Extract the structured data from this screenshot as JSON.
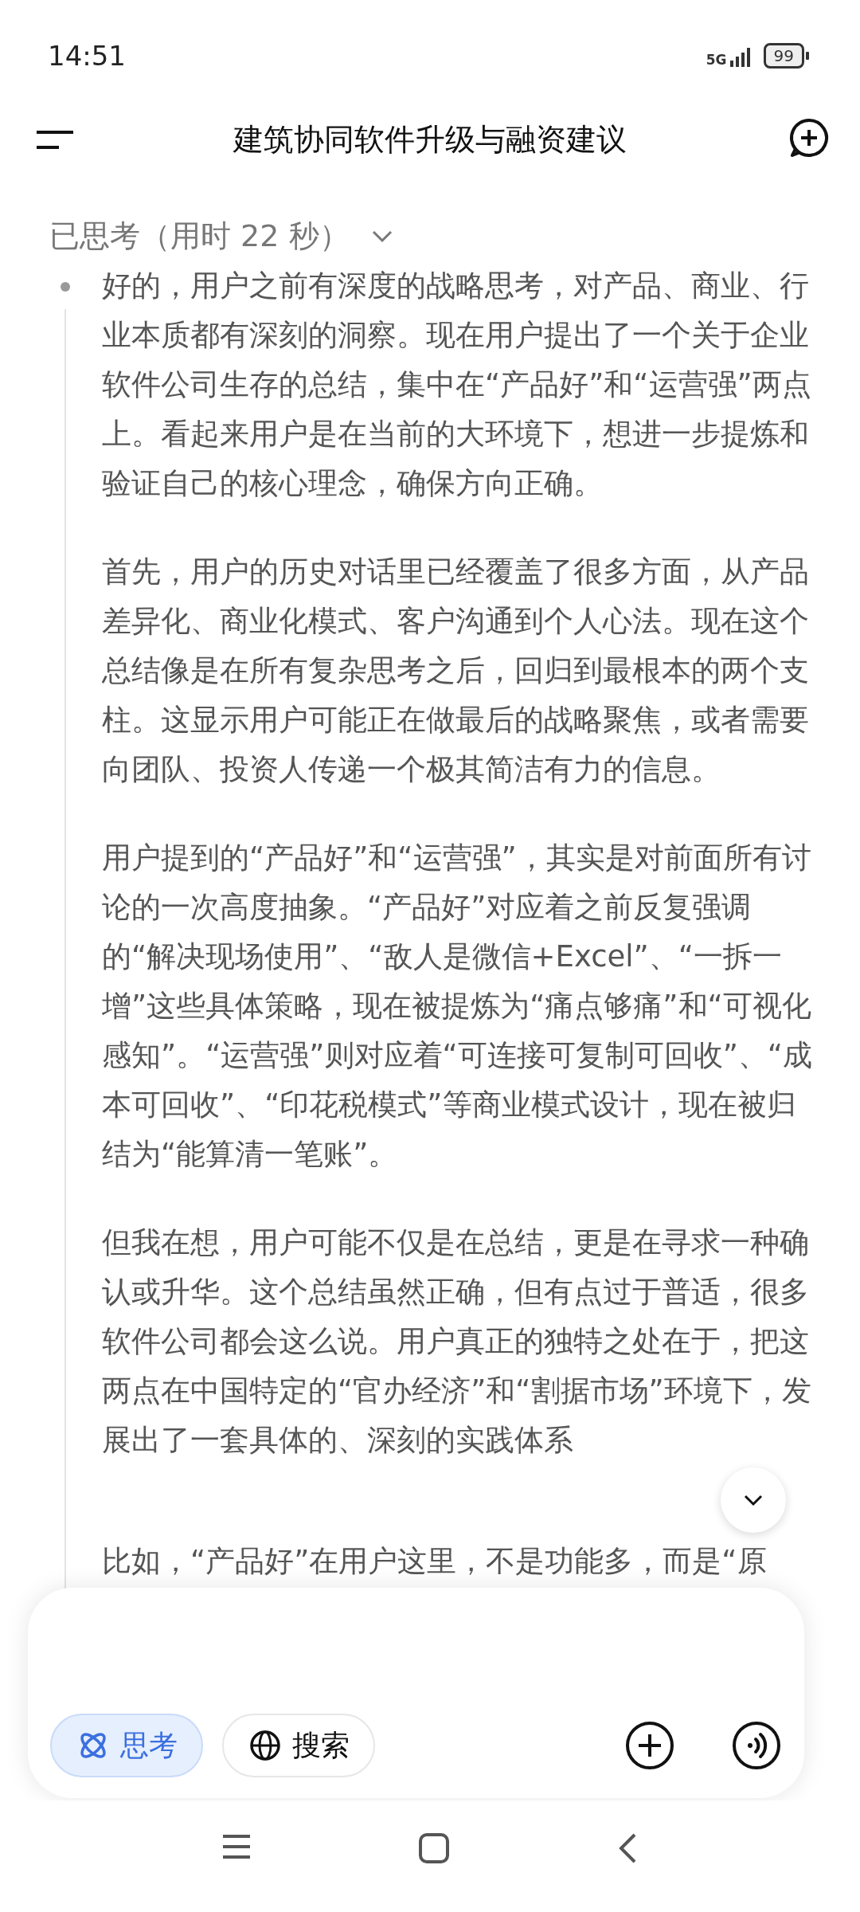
{
  "status_bar": {
    "time": "14:51",
    "network": "5G",
    "battery": "99"
  },
  "header": {
    "title": "建筑协同软件升级与融资建议"
  },
  "thinking": {
    "title": "已思考（用时 22 秒）",
    "expanded": true,
    "paragraphs": [
      "好的，用户之前有深度的战略思考，对产品、商业、行业本质都有深刻的洞察。现在用户提出了一个关于企业软件公司生存的总结，集中在“产品好”和“运营强”两点上。看起来用户是在当前的大环境下，想进一步提炼和验证自己的核心理念，确保方向正确。",
      "首先，用户的历史对话里已经覆盖了很多方面，从产品差异化、商业化模式、客户沟通到个人心法。现在这个总结像是在所有复杂思考之后，回归到最根本的两个支柱。这显示用户可能正在做最后的战略聚焦，或者需要向团队、投资人传递一个极其简洁有力的信息。",
      "用户提到的“产品好”和“运营强”，其实是对前面所有讨论的一次高度抽象。“产品好”对应着之前反复强调的“解决现场使用”、“敌人是微信+Excel”、“一拆一增”这些具体策略，现在被提炼为“痛点够痛”和“可视化感知”。“运营强”则对应着“可连接可复制可回收”、“成本可回收”、“印花税模式”等商业模式设计，现在被归结为“能算清一笔账”。",
      "但我在想，用户可能不仅是在总结，更是在寻求一种确认或升华。这个总结虽然正确，但有点过于普适，很多软件公司都会这么说。用户真正的独特之处在于，把这两点在中国特定的“官办经济”和“割据市场”环境下，发展出了一套具体的、深刻的实践体系",
      "比如，“产品好”在用户这里，不是功能多，而是“原"
    ]
  },
  "composer": {
    "chips": [
      {
        "kind": "think",
        "label": "思考",
        "selected": true
      },
      {
        "kind": "search",
        "label": "搜索",
        "selected": false
      }
    ]
  }
}
